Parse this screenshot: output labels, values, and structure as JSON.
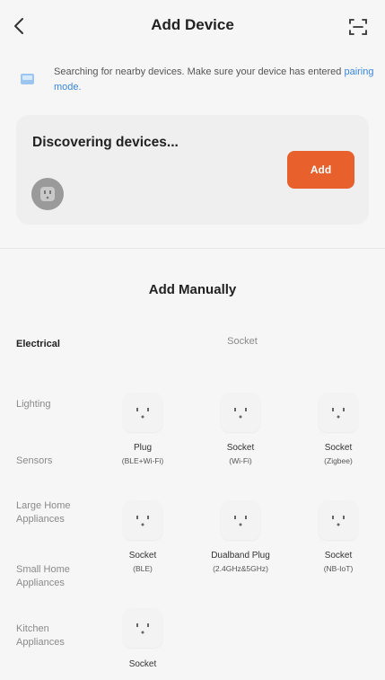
{
  "header": {
    "title": "Add Device"
  },
  "notice": {
    "text": "Searching for nearby devices. Make sure your device has entered",
    "link": "pairing mode."
  },
  "discovery": {
    "title": "Discovering devices...",
    "add_label": "Add"
  },
  "manual": {
    "title": "Add Manually",
    "group_title": "Socket",
    "categories": [
      "Electrical",
      "Lighting",
      "Sensors",
      "Large Home Appliances",
      "Small Home Appliances",
      "Kitchen Appliances"
    ],
    "devices": [
      {
        "name": "Plug",
        "sub": "(BLE+Wi-Fi)"
      },
      {
        "name": "Socket",
        "sub": "(Wi-Fi)"
      },
      {
        "name": "Socket",
        "sub": "(Zigbee)"
      },
      {
        "name": "Socket",
        "sub": "(BLE)"
      },
      {
        "name": "Dualband Plug",
        "sub": "(2.4GHz&5GHz)"
      },
      {
        "name": "Socket",
        "sub": "(NB-IoT)"
      },
      {
        "name": "Socket",
        "sub": ""
      }
    ]
  },
  "colors": {
    "accent": "#e8602c",
    "link": "#3a86d9"
  }
}
